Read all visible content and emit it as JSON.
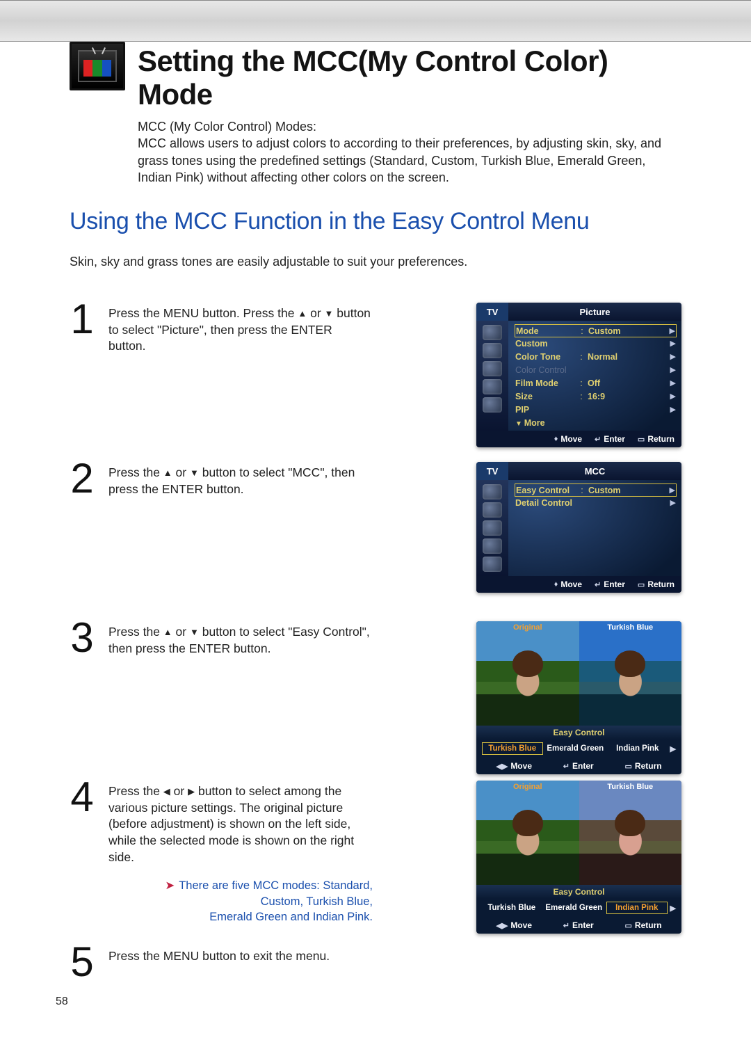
{
  "page_number": "58",
  "header": {
    "title": "Setting the MCC(My Control Color) Mode",
    "intro_label": "MCC (My Color Control) Modes:",
    "intro_body": "MCC allows users to adjust colors to according to their preferences, by adjusting skin, sky, and grass tones using the predefined settings (Standard, Custom, Turkish Blue, Emerald Green, Indian Pink) without affecting other colors on the screen."
  },
  "subtitle": "Using the MCC Function in the Easy Control Menu",
  "lead": "Skin, sky and grass tones are easily adjustable to suit your preferences.",
  "steps": {
    "s1": {
      "num": "1",
      "pre": "Press the MENU button. Press the ",
      "mid": " or ",
      "post": " button to select \"Picture\", then press the ENTER button."
    },
    "s2": {
      "num": "2",
      "pre": "Press the ",
      "mid": " or ",
      "post": " button to select \"MCC\", then press the ENTER button."
    },
    "s3": {
      "num": "3",
      "pre": "Press the ",
      "mid": " or ",
      "post": " button to select \"Easy Control\", then press the ENTER button."
    },
    "s4": {
      "num": "4",
      "pre": "Press the ",
      "mid": " or ",
      "post": " button to select among the various picture settings. The original picture (before adjustment) is shown on the left side, while the selected mode is shown on the right side.",
      "note1": "There are five MCC modes: Standard, Custom, Turkish Blue,",
      "note2": "Emerald Green and Indian Pink."
    },
    "s5": {
      "num": "5",
      "text": "Press the MENU button to exit the menu."
    }
  },
  "osd": {
    "tv": "TV",
    "foot_move": "Move",
    "foot_enter": "Enter",
    "foot_return": "Return",
    "picture": {
      "title": "Picture",
      "rows": [
        {
          "lbl": "Mode",
          "val": "Custom",
          "sel": true
        },
        {
          "lbl": "Custom",
          "val": ""
        },
        {
          "lbl": "Color Tone",
          "val": "Normal"
        },
        {
          "lbl": "Color Control",
          "val": "",
          "dim": true
        },
        {
          "lbl": "Film Mode",
          "val": "Off"
        },
        {
          "lbl": "Size",
          "val": "16:9"
        },
        {
          "lbl": "PIP",
          "val": ""
        },
        {
          "lbl": "More",
          "val": "",
          "more": true
        }
      ]
    },
    "mcc": {
      "title": "MCC",
      "rows": [
        {
          "lbl": "Easy Control",
          "val": "Custom",
          "sel": true
        },
        {
          "lbl": "Detail Control",
          "val": ""
        }
      ]
    }
  },
  "cmp": {
    "bar": "Easy Control",
    "left": "Original",
    "right_a": "Turkish Blue",
    "right_b": "Turkish Blue",
    "opts_a": [
      "Turkish Blue",
      "Emerald Green",
      "Indian Pink"
    ],
    "opts_b": [
      "Turkish Blue",
      "Emerald Green",
      "Indian Pink"
    ]
  }
}
